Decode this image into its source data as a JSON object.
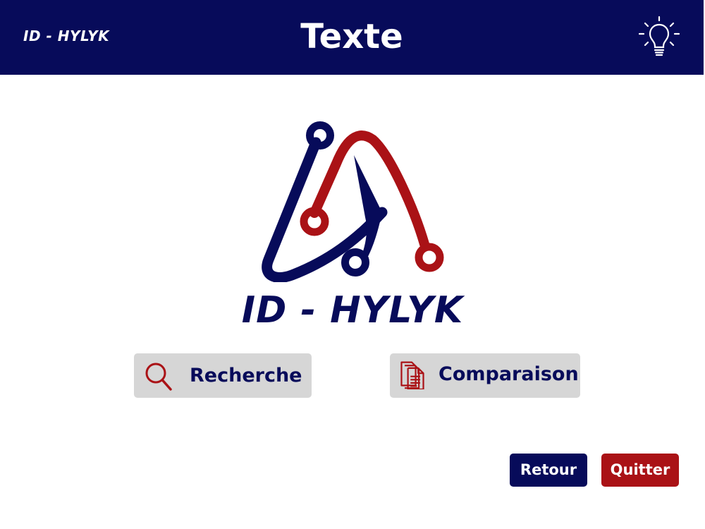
{
  "header": {
    "brand": "ID - HYLYK",
    "title": "Texte",
    "tip_icon": "lightbulb-icon"
  },
  "logo": {
    "name": "ID - HYLYK",
    "colors": {
      "navy": "#070b5a",
      "red": "#aa1216"
    }
  },
  "actions": [
    {
      "label": "Recherche",
      "icon": "magnifier-icon"
    },
    {
      "label": "Comparaison",
      "icon": "documents-icon"
    }
  ],
  "footer": {
    "back_label": "Retour",
    "quit_label": "Quitter"
  },
  "colors": {
    "header_bg": "#070b5a",
    "choice_bg": "#d6d6d6",
    "back_bg": "#070b5a",
    "quit_bg": "#aa1216"
  }
}
